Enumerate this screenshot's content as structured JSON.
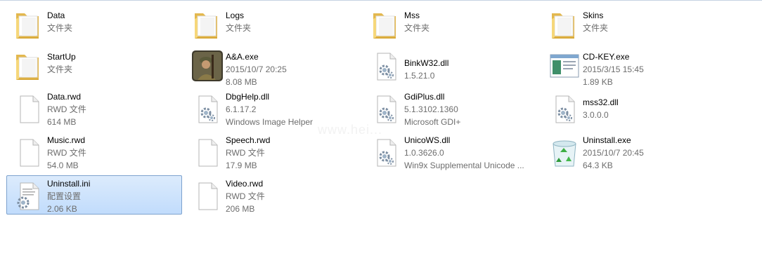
{
  "files": [
    {
      "name": "Data",
      "line2": "文件夹",
      "line3": "",
      "icon": "folder-icon"
    },
    {
      "name": "Logs",
      "line2": "文件夹",
      "line3": "",
      "icon": "folder-icon"
    },
    {
      "name": "Mss",
      "line2": "文件夹",
      "line3": "",
      "icon": "folder-icon"
    },
    {
      "name": "Skins",
      "line2": "文件夹",
      "line3": "",
      "icon": "folder-icon"
    },
    {
      "name": "StartUp",
      "line2": "文件夹",
      "line3": "",
      "icon": "folder-icon"
    },
    {
      "name": "A&A.exe",
      "line2": "2015/10/7 20:25",
      "line3": "8.08 MB",
      "icon": "soldier-app-icon"
    },
    {
      "name": "BinkW32.dll",
      "line2": "1.5.21.0",
      "line3": "",
      "icon": "dll-gear-icon"
    },
    {
      "name": "CD-KEY.exe",
      "line2": "2015/3/15 15:45",
      "line3": "1.89 KB",
      "icon": "window-app-icon"
    },
    {
      "name": "Data.rwd",
      "line2": "RWD 文件",
      "line3": "614 MB",
      "icon": "blank-file-icon"
    },
    {
      "name": "DbgHelp.dll",
      "line2": "6.1.17.2",
      "line3": "Windows Image Helper",
      "icon": "dll-gear-icon"
    },
    {
      "name": "GdiPlus.dll",
      "line2": "5.1.3102.1360",
      "line3": "Microsoft GDI+",
      "icon": "dll-gear-icon"
    },
    {
      "name": "mss32.dll",
      "line2": "3.0.0.0",
      "line3": "",
      "icon": "dll-gear-icon"
    },
    {
      "name": "Music.rwd",
      "line2": "RWD 文件",
      "line3": "54.0 MB",
      "icon": "blank-file-icon"
    },
    {
      "name": "Speech.rwd",
      "line2": "RWD 文件",
      "line3": "17.9 MB",
      "icon": "blank-file-icon"
    },
    {
      "name": "UnicoWS.dll",
      "line2": "1.0.3626.0",
      "line3": "Win9x Supplemental Unicode ...",
      "icon": "dll-gear-icon"
    },
    {
      "name": "Uninstall.exe",
      "line2": "2015/10/7 20:45",
      "line3": "64.3 KB",
      "icon": "recycle-bin-icon"
    },
    {
      "name": "Uninstall.ini",
      "line2": "配置设置",
      "line3": "2.06 KB",
      "icon": "ini-settings-icon"
    },
    {
      "name": "Video.rwd",
      "line2": "RWD 文件",
      "line3": "206 MB",
      "icon": "blank-file-icon"
    }
  ],
  "selected_file": "Uninstall.ini",
  "watermark": "www.hei...",
  "colors": {
    "selection_fill": "#cce4fc",
    "selection_border": "#7da2ce",
    "folder": "#f1cf68",
    "secondary_text": "#6d6d6d"
  }
}
